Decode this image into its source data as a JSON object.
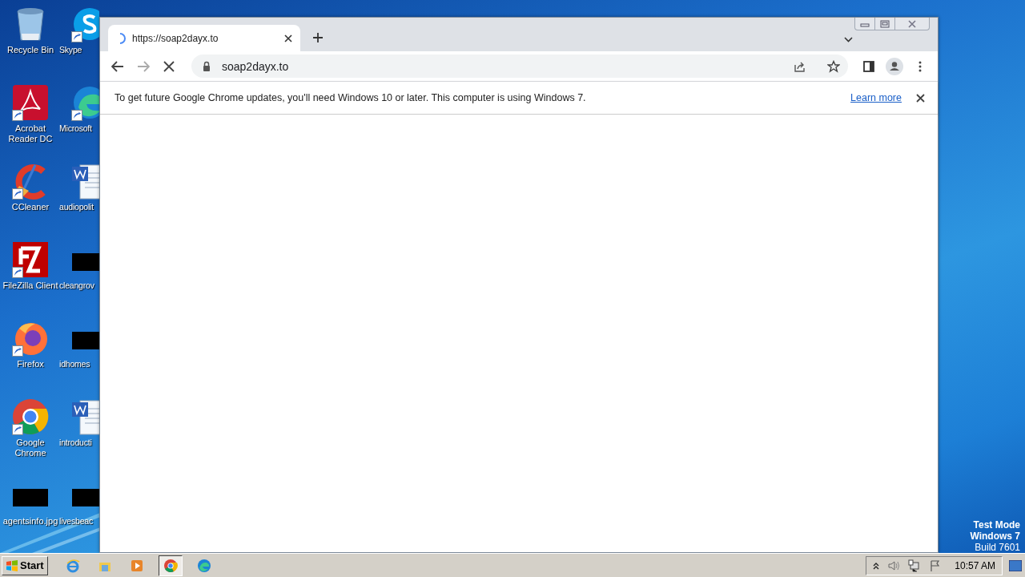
{
  "desktop": {
    "icons": [
      {
        "label": "Recycle Bin",
        "kind": "recycle",
        "shortcut": false
      },
      {
        "label": "Acrobat Reader DC",
        "kind": "acrobat",
        "shortcut": true
      },
      {
        "label": "CCleaner",
        "kind": "ccleaner",
        "shortcut": true
      },
      {
        "label": "FileZilla Client",
        "kind": "filezilla",
        "shortcut": true
      },
      {
        "label": "Firefox",
        "kind": "firefox",
        "shortcut": true
      },
      {
        "label": "Google Chrome",
        "kind": "chrome",
        "shortcut": true
      },
      {
        "label": "agentsinfo.jpg",
        "kind": "thumb",
        "shortcut": false
      },
      {
        "label": "Skype",
        "kind": "skype",
        "shortcut": true
      },
      {
        "label": "Microsoft",
        "kind": "edge",
        "shortcut": true
      },
      {
        "label": "audiopolit",
        "kind": "word",
        "shortcut": false
      },
      {
        "label": "cleangrov",
        "kind": "thumb",
        "shortcut": false
      },
      {
        "label": "idhomes",
        "kind": "thumb",
        "shortcut": false
      },
      {
        "label": "introducti",
        "kind": "word",
        "shortcut": false
      },
      {
        "label": "livesbeac",
        "kind": "thumb",
        "shortcut": false
      }
    ],
    "os_notice": [
      "Test Mode",
      "Windows 7",
      "Build 7601"
    ]
  },
  "browser": {
    "tabs": [
      {
        "title": "https://soap2dayx.to",
        "selected": true,
        "loading": true
      }
    ],
    "address": {
      "url": "soap2dayx.to",
      "secure": true
    },
    "infobar": {
      "message": "To get future Google Chrome updates, you'll need Windows 10 or later. This computer is using Windows 7.",
      "link": "Learn more"
    }
  },
  "taskbar": {
    "start": "Start",
    "apps": [
      {
        "kind": "ie",
        "selected": false
      },
      {
        "kind": "explorer",
        "selected": false
      },
      {
        "kind": "media",
        "selected": false
      },
      {
        "kind": "chrome",
        "selected": true
      },
      {
        "kind": "edge",
        "selected": false
      }
    ],
    "clock": "10:57 AM"
  }
}
